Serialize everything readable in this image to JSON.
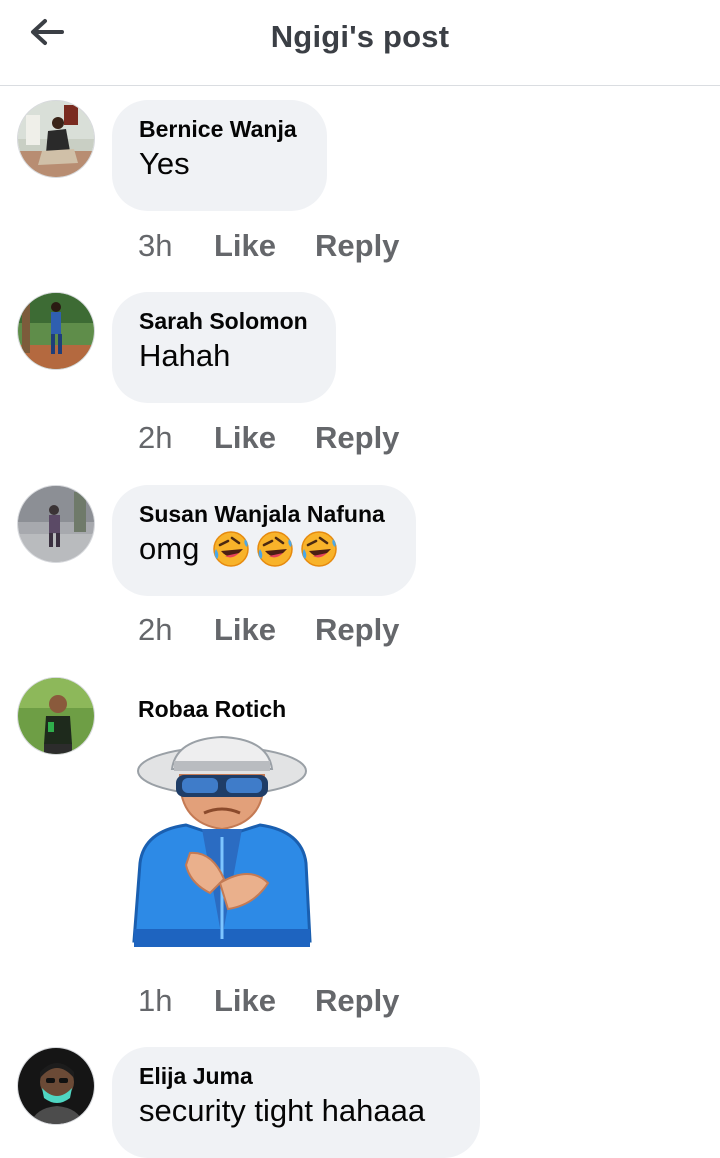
{
  "header": {
    "title": "Ngigi's post",
    "back_icon": "arrow-left-icon"
  },
  "colors": {
    "bubble": "#f0f2f5",
    "meta_text": "#65676b",
    "title_text": "#3b3f45"
  },
  "comments": [
    {
      "author": "Bernice Wanja",
      "text": "Yes",
      "time": "3h",
      "like": "Like",
      "reply": "Reply"
    },
    {
      "author": "Sarah Solomon",
      "text": "Hahah",
      "time": "2h",
      "like": "Like",
      "reply": "Reply"
    },
    {
      "author": "Susan Wanjala Nafuna",
      "text": "omg",
      "emojis": [
        "rolling-on-floor-laughing",
        "rolling-on-floor-laughing",
        "rolling-on-floor-laughing"
      ],
      "time": "2h",
      "like": "Like",
      "reply": "Reply"
    },
    {
      "author": "Robaa Rotich",
      "sticker": "cool-grandpa-clapping-sticker",
      "time": "1h",
      "like": "Like",
      "reply": "Reply"
    },
    {
      "author": "Elija Juma",
      "text": "security tight hahaaa"
    }
  ]
}
